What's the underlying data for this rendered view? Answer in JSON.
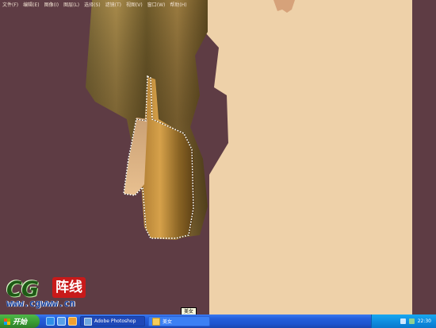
{
  "menu": [
    "文件(F)",
    "编辑(E)",
    "图像(I)",
    "图层(L)",
    "选择(S)",
    "滤镜(T)",
    "视图(V)",
    "窗口(W)",
    "帮助(H)"
  ],
  "watermark": {
    "cg": "CG",
    "cn": "阵线",
    "url": "www.cgwww.cn"
  },
  "tooltip": "美女",
  "taskbar": {
    "start_label": "开始",
    "tasks": [
      "Adobe Photoshop",
      "美女"
    ],
    "clock": "22:30"
  },
  "colors": {
    "background": "#5e3c44",
    "skin": "#eed1a9",
    "taskbar": "#245edb"
  }
}
